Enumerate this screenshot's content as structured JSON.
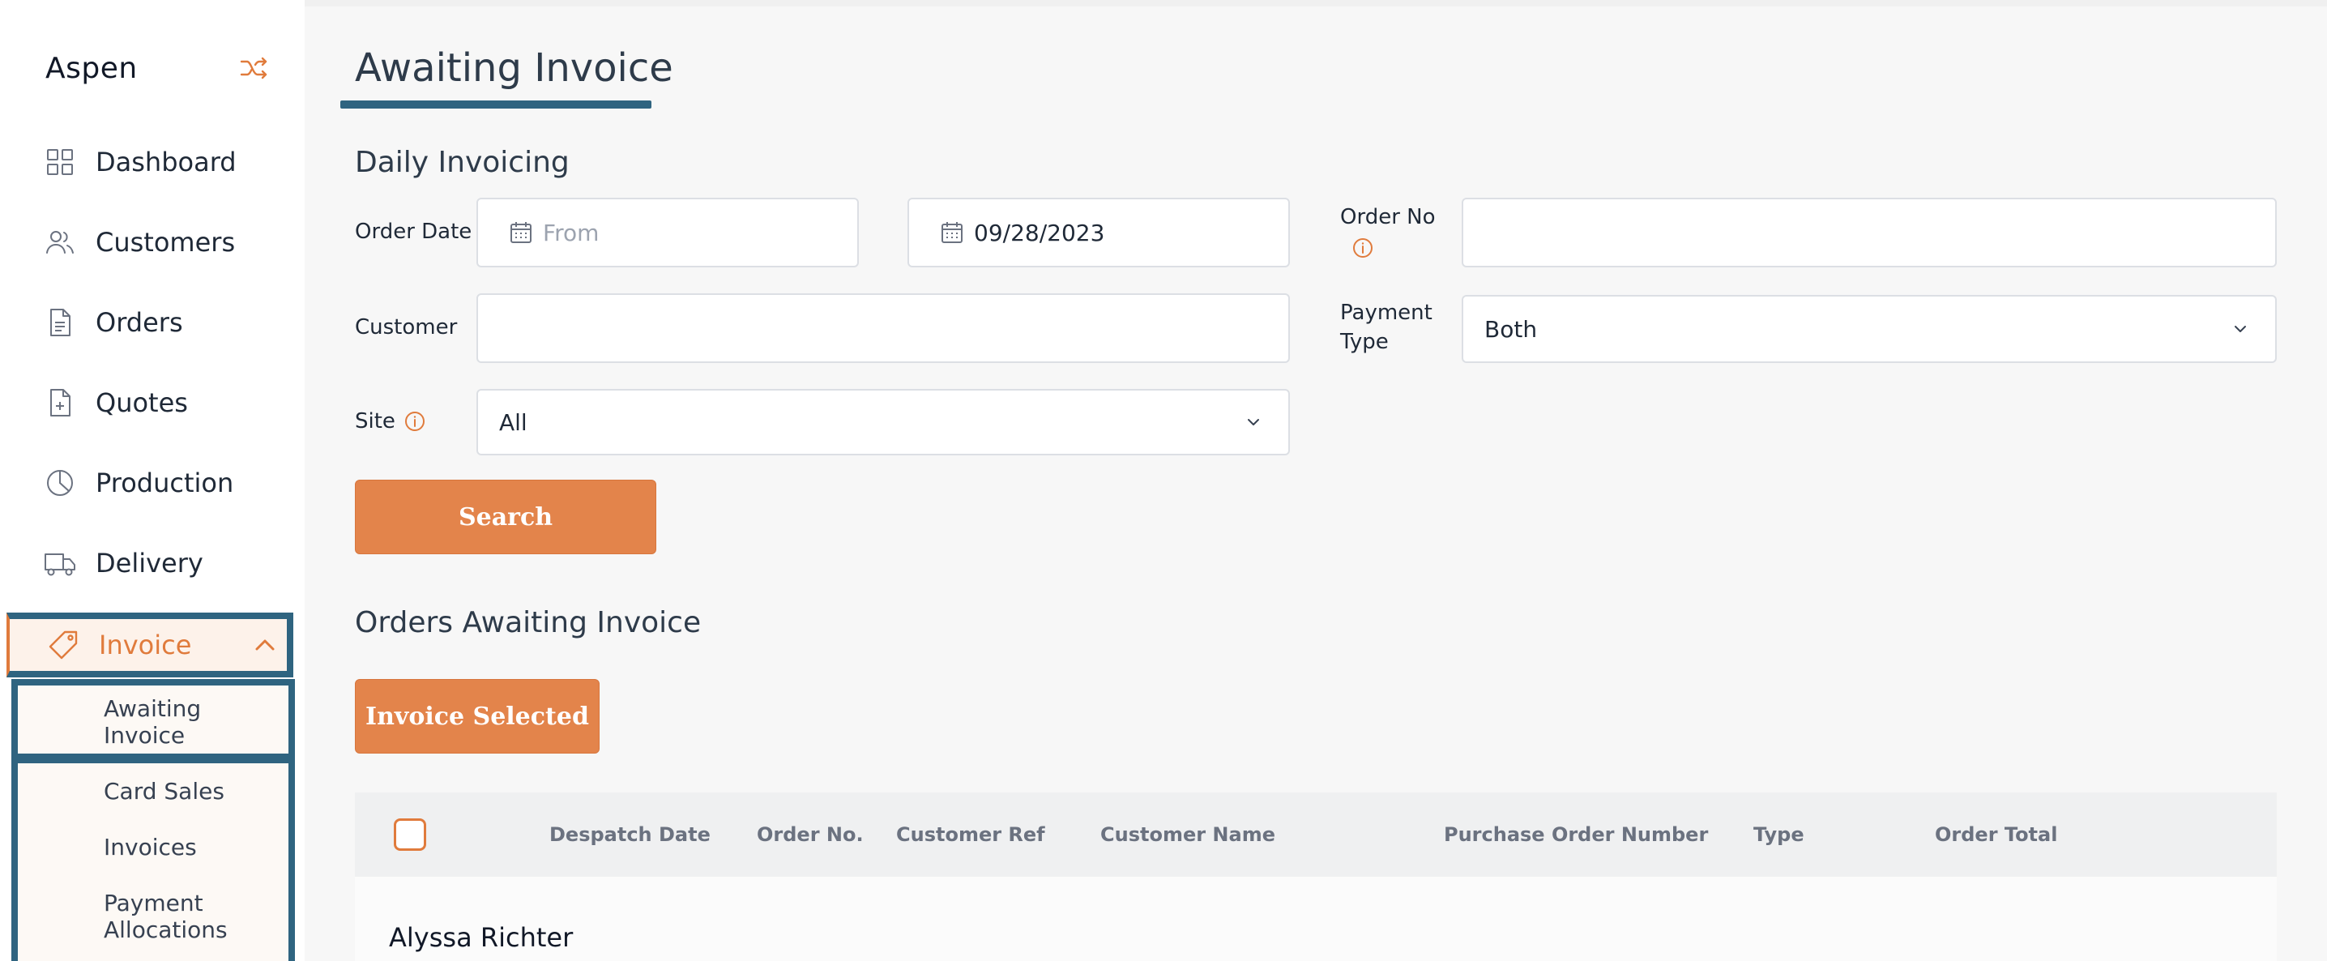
{
  "app": {
    "brand": "Aspen",
    "accent_color": "#e07b3c",
    "highlight_color": "#2f6480"
  },
  "sidebar": {
    "items": [
      {
        "label": "Dashboard",
        "icon": "grid-icon"
      },
      {
        "label": "Customers",
        "icon": "users-icon"
      },
      {
        "label": "Orders",
        "icon": "document-icon"
      },
      {
        "label": "Quotes",
        "icon": "document-plus-icon"
      },
      {
        "label": "Production",
        "icon": "pie-chart-icon"
      },
      {
        "label": "Delivery",
        "icon": "truck-icon"
      },
      {
        "label": "Invoice",
        "icon": "tag-icon"
      }
    ],
    "invoice_submenu": [
      {
        "label": "Awaiting Invoice"
      },
      {
        "label": "Card Sales"
      },
      {
        "label": "Invoices"
      },
      {
        "label": "Payment Allocations"
      }
    ]
  },
  "main": {
    "page_title": "Awaiting Invoice",
    "filter_section_title": "Daily Invoicing",
    "filters": {
      "order_date_label": "Order Date",
      "from_placeholder": "From",
      "to_value": "09/28/2023",
      "order_no_label": "Order No",
      "order_no_value": "",
      "customer_label": "Customer",
      "customer_value": "",
      "payment_type_label": "Payment Type",
      "payment_type_value": "Both",
      "site_label": "Site",
      "site_value": "All"
    },
    "search_button": "Search",
    "orders_section_title": "Orders Awaiting Invoice",
    "invoice_selected_button": "Invoice Selected",
    "table": {
      "columns": [
        "Despatch Date",
        "Order No.",
        "Customer Ref",
        "Customer Name",
        "Purchase Order Number",
        "Type",
        "Order Total"
      ],
      "groups": [
        {
          "name": "Alyssa Richter"
        }
      ]
    }
  }
}
